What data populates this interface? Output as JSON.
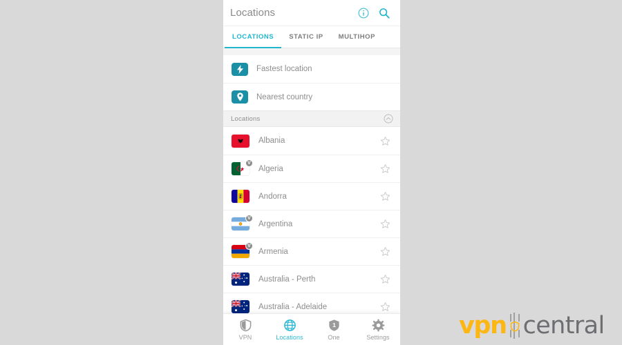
{
  "theme": {
    "accent": "#1fb6cd",
    "badge_teal": "#1a8fa6",
    "nav_active": "#2cb8d4",
    "text_muted": "#8d8d8d",
    "panel_bg": "#ffffff",
    "page_bg": "#d9d9d9",
    "brand_orange": "#fdb714",
    "brand_gray": "#6d6e71"
  },
  "header": {
    "title": "Locations",
    "info_icon": "info-circle-icon",
    "search_icon": "search-icon"
  },
  "tabs": [
    {
      "label": "LOCATIONS",
      "active": true
    },
    {
      "label": "STATIC IP",
      "active": false
    },
    {
      "label": "MULTIHOP",
      "active": false
    }
  ],
  "quick_actions": [
    {
      "label": "Fastest location",
      "icon": "lightning-bolt-icon"
    },
    {
      "label": "Nearest country",
      "icon": "map-pin-icon"
    }
  ],
  "section": {
    "label": "Locations",
    "collapse_icon": "chevron-up-circle-icon"
  },
  "countries": [
    {
      "name": "Albania",
      "flag": "albania",
      "virtual": false,
      "favorite": false
    },
    {
      "name": "Algeria",
      "flag": "algeria",
      "virtual": true,
      "favorite": false
    },
    {
      "name": "Andorra",
      "flag": "andorra",
      "virtual": false,
      "favorite": false
    },
    {
      "name": "Argentina",
      "flag": "argentina",
      "virtual": true,
      "favorite": false
    },
    {
      "name": "Armenia",
      "flag": "armenia",
      "virtual": true,
      "favorite": false
    },
    {
      "name": "Australia - Perth",
      "flag": "australia",
      "virtual": false,
      "favorite": false
    },
    {
      "name": "Australia - Adelaide",
      "flag": "australia",
      "virtual": false,
      "favorite": false
    }
  ],
  "bottom_nav": [
    {
      "label": "VPN",
      "icon": "shield-icon",
      "active": false
    },
    {
      "label": "Locations",
      "icon": "globe-icon",
      "active": true
    },
    {
      "label": "One",
      "icon": "shield-one-icon",
      "active": false
    },
    {
      "label": "Settings",
      "icon": "gear-icon",
      "active": false
    }
  ],
  "watermark": {
    "primary": "vpn",
    "secondary": "central",
    "separator_icon": "shield-bars-icon"
  }
}
